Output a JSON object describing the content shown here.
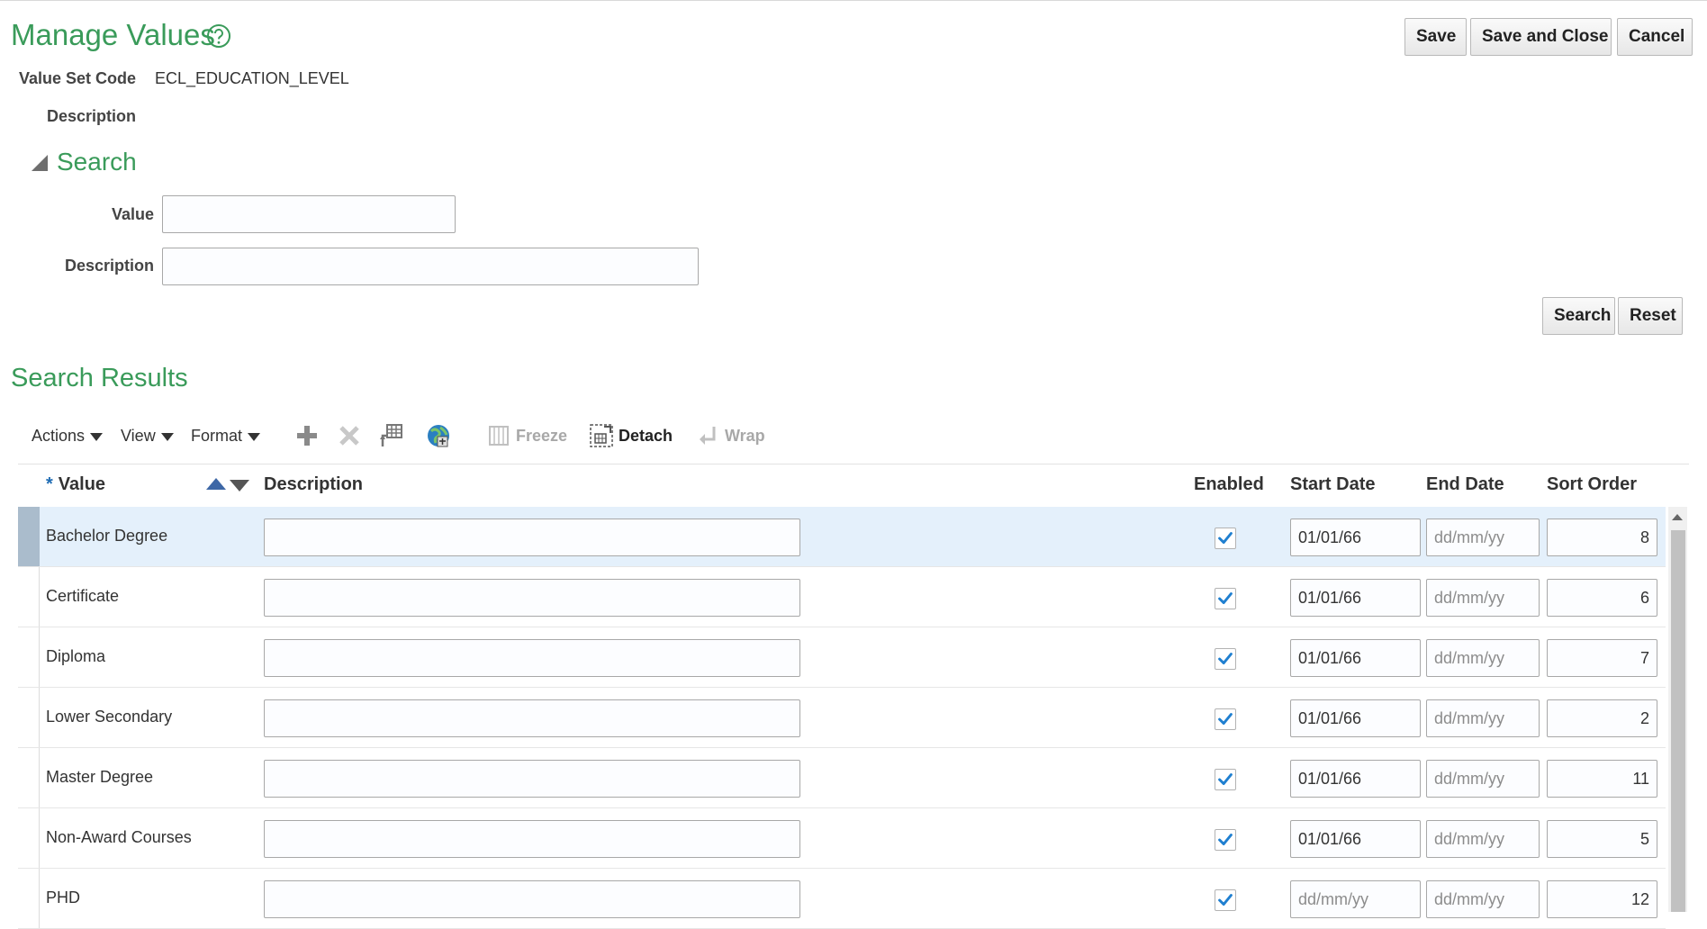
{
  "page": {
    "title": "Manage Values"
  },
  "buttons": {
    "save": "Save",
    "save_close": "Save and Close",
    "cancel": "Cancel",
    "search": "Search",
    "reset": "Reset"
  },
  "info": {
    "value_set_code_label": "Value Set Code",
    "value_set_code": "ECL_EDUCATION_LEVEL",
    "description_label": "Description"
  },
  "search": {
    "heading": "Search",
    "value_label": "Value",
    "value_input": "",
    "description_label": "Description",
    "description_input": ""
  },
  "results": {
    "heading": "Search Results",
    "toolbar": {
      "actions": "Actions",
      "view": "View",
      "format": "Format",
      "freeze": "Freeze",
      "detach": "Detach",
      "wrap": "Wrap",
      "icons": [
        "add-icon",
        "delete-icon",
        "export-grid-icon",
        "globe-translate-icon",
        "freeze-icon",
        "detach-icon",
        "wrap-icon"
      ]
    },
    "columns": {
      "value": "Value",
      "description": "Description",
      "enabled": "Enabled",
      "start_date": "Start Date",
      "end_date": "End Date",
      "sort_order": "Sort Order"
    },
    "date_placeholder": "dd/mm/yy",
    "rows": [
      {
        "value": "Bachelor Degree",
        "description": "",
        "enabled": true,
        "start_date": "01/01/66",
        "end_date": "",
        "sort_order": "8"
      },
      {
        "value": "Certificate",
        "description": "",
        "enabled": true,
        "start_date": "01/01/66",
        "end_date": "",
        "sort_order": "6"
      },
      {
        "value": "Diploma",
        "description": "",
        "enabled": true,
        "start_date": "01/01/66",
        "end_date": "",
        "sort_order": "7"
      },
      {
        "value": "Lower Secondary",
        "description": "",
        "enabled": true,
        "start_date": "01/01/66",
        "end_date": "",
        "sort_order": "2"
      },
      {
        "value": "Master Degree",
        "description": "",
        "enabled": true,
        "start_date": "01/01/66",
        "end_date": "",
        "sort_order": "11"
      },
      {
        "value": "Non-Award Courses",
        "description": "",
        "enabled": true,
        "start_date": "01/01/66",
        "end_date": "",
        "sort_order": "5"
      },
      {
        "value": "PHD",
        "description": "",
        "enabled": true,
        "start_date": "",
        "end_date": "",
        "sort_order": "12"
      }
    ]
  },
  "colors": {
    "heading_green": "#3a9b5a",
    "check_blue": "#1f7fd0",
    "selected_row": "#e4f0fb"
  }
}
